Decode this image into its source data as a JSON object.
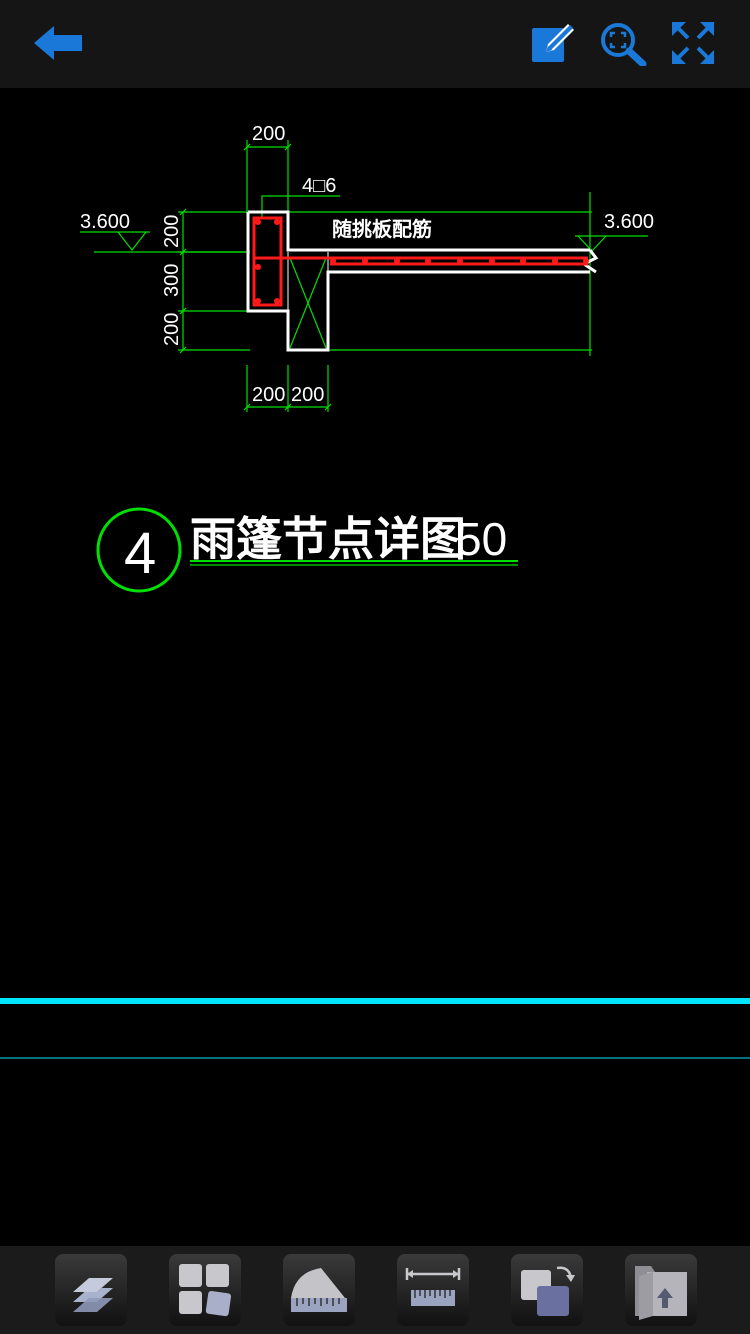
{
  "toolbar_top": {
    "back_icon": "arrow-left-icon",
    "edit_icon": "pencil-square-icon",
    "zoom_icon": "zoom-extents-icon",
    "fullscreen_icon": "expand-icon",
    "accent_color": "#1a78d8"
  },
  "drawing": {
    "dim_top": "200",
    "rebar_label": "4□6",
    "level_left": "3.600",
    "level_right": "3.600",
    "slab_note": "随挑板配筋",
    "dim_v1": "200",
    "dim_v2": "300",
    "dim_v3": "200",
    "dim_bottom_1": "200",
    "dim_bottom_2": "200",
    "detail_number": "4",
    "detail_title": "雨篷节点详图",
    "detail_scale": "50",
    "colors": {
      "dimension": "#00e000",
      "outline": "#ffffff",
      "rebar": "#ff1a1a",
      "cyan_line": "#00e5ff"
    }
  },
  "toolbar_bottom": [
    {
      "icon": "layers-icon"
    },
    {
      "icon": "layouts-icon"
    },
    {
      "icon": "measure-area-icon"
    },
    {
      "icon": "measure-distance-icon"
    },
    {
      "icon": "switch-background-icon"
    },
    {
      "icon": "export-icon"
    }
  ]
}
